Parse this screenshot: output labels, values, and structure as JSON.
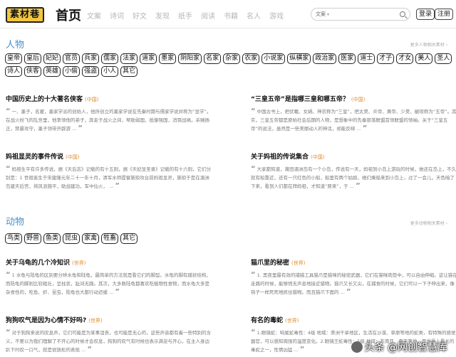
{
  "header": {
    "logo": "素材巷",
    "home": "首页",
    "nav": [
      "文案",
      "诗词",
      "好文",
      "发现",
      "纸手",
      "阅读",
      "书籍",
      "名人",
      "游戏"
    ],
    "search_category": "文案",
    "search_caret": "▾",
    "login": "登录",
    "register": "注册"
  },
  "sections": [
    {
      "title": "人物",
      "more": "更多人物相关素材 ›",
      "tags": [
        "皇帝",
        "皇后",
        "妃妃",
        "官员",
        "兵家",
        "儒家",
        "法家",
        "道家",
        "墨家",
        "阴阳家",
        "名家",
        "杂家",
        "农家",
        "小说家",
        "纵横家",
        "政治家",
        "医家",
        "道士",
        "才子",
        "才女",
        "美人",
        "圣人",
        "诗人",
        "侠客",
        "英雄",
        "小偷",
        "强盗",
        "小人",
        "其它"
      ],
      "articles": [
        {
          "title": "中国历史上的十大著名侠客",
          "src": "(中国)",
          "body": "一、墨子，名翟，墨家学派的创始人，他所创立的墨家学说在先秦时期与儒家学说并称为“显学”。在战火纷飞的乱世里，他率领他的弟子，奔走于战火之间，帮助弱国，抵御强国，消弭战祸，杀贼扬正，禁暴攻守，墨子领带开辟游 ..."
        },
        {
          "title": "“三皇五帝”是指哪三皇和哪五帝？",
          "src": "(中国)",
          "body": "中国古书上，把伏羲、女娲、神农称为“三皇”，把太昊、炎帝、黄帝、少昊、颛顼称为“五帝”。其实，三皇五帝都是原始社会后期的人物，是想象中的先秦部落联盟首领联盟的领袖。关于“三皇五帝”的说法，虽然是一些美丽动人的神话，却能反映 ..."
        },
        {
          "title": "妈祖显灵的事件传说",
          "src": "(中国)",
          "body": "妈祖生平有许多传说，据《天后志》记载的有十五则，据《天妃显圣录》记载的有十六则，它们分别是：1 世祖诞生于宋建隆元年二十一年十月，清军水师提督施琅攻台前妈祖显灵，施琅于是在湄洲岛建天后宫，将风浪施平，助战建功，军中仙火， ..."
        },
        {
          "title": "关于妈祖的传说集合",
          "src": "(中国)",
          "body": "大家都知道，莆田湄洲岛有一个小岛，传说有一天，妈祖到小岛上游玩的时候，她还在岛上，不久就有船靠近，还有一只红色的小船，船里有两个姑娘，她们乘船来到小岛上，过了一会儿，天色暗了下来，看到人们都在拜妈祖，才知道“原来”，于 ..."
        }
      ]
    },
    {
      "title": "动物",
      "more": "更多动物相关素材 ›",
      "tags": [
        "鸟类",
        "野兽",
        "鱼类",
        "昆虫",
        "家禽",
        "牲畜",
        "其它"
      ],
      "articles": [
        {
          "title": "关于乌龟的几个冷知识",
          "src": "(世界)",
          "body": "1 水龟与陆龟的区别要分辨水龟和陆龟，最简单的方法就是看它们的脚型。水龟的脚有蹼状结构，而陆龟的脚则比较粗壮，呈柱状，趾间无蹼。其次，大多数陆龟都喜欢吃植物性食物，而水龟大多是杂食性的，吃鱼、虾、昆虫，陆龟也大都行动迟缓 ..."
        },
        {
          "title": "猫爪里的秘密",
          "src": "(世界)",
          "body": "1. 黑夜里最有效的捕猎工具猫爪是猫咪的秘密武器，它们在猫咪肉垫中，可以自由伸缩。这让猫在走路的时候，能够悄无声息地接近猎物。猫爪又长又尖，在捕食的时候，它们可以一下子伸出来，像钩子一样死死地抓住猎物。而且猫爪下面的 ..."
        },
        {
          "title": "狗狗叹气是因为心情不好吗?",
          "src": "(世界)",
          "body": "对于狗狗来说的叹息声，它们可能是为某事沮丧，也可能是无心的，这些声音都有着一些特别的含义，不要以为我们理解了不开心的时候才会叹息，狗狗的叹气有时候也表示满足与开心，在主人身边趴下时叹一口气，就是很放松的表现 ..."
        },
        {
          "title": "有名的毒蛇",
          "src": "(世界)",
          "body": "1.眼镜蛇：响尾蛇毒性：4级 地域：美洲干旱地区，生活在沙漠、草原等地的蛇类，有特殊的感觉器官，可以感知周围的温度变化。2.眼镜王蛇毒性：5级 地域：东南亚、南亚等地，是世界上最长的毒蛇之一，性情凶猛 ..."
        }
      ]
    }
  ],
  "watermark": "头条 @网创智慧库"
}
